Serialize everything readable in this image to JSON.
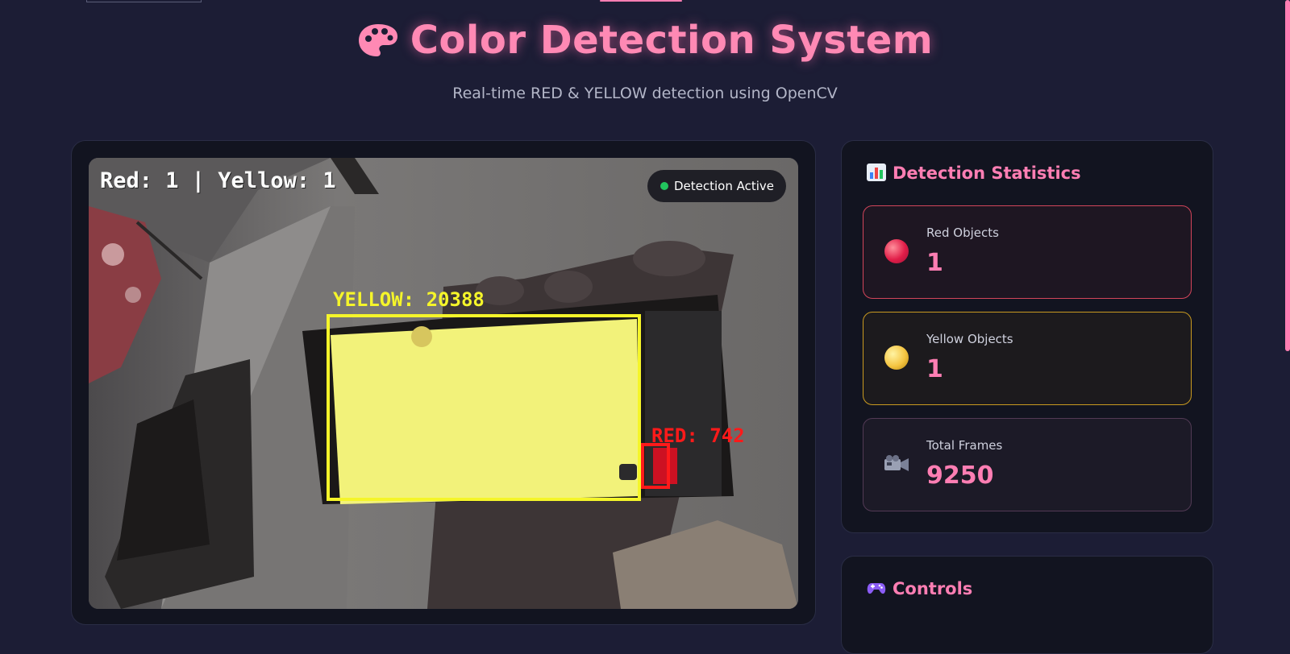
{
  "header": {
    "title": "Color Detection System",
    "subtitle": "Real-time RED & YELLOW detection using OpenCV",
    "icon": "palette-icon"
  },
  "video": {
    "overlay_text": "Red: 1 | Yellow: 1",
    "status_badge": "Detection Active",
    "detections": [
      {
        "label": "YELLOW: 20388",
        "color": "#f5f52a"
      },
      {
        "label": "RED: 742",
        "color": "#ff1a1a"
      }
    ]
  },
  "stats": {
    "heading": "Detection Statistics",
    "heading_icon": "bar-chart-icon",
    "cards": [
      {
        "label": "Red Objects",
        "value": "1",
        "icon": "red-circle-icon"
      },
      {
        "label": "Yellow Objects",
        "value": "1",
        "icon": "yellow-circle-icon"
      },
      {
        "label": "Total Frames",
        "value": "9250",
        "icon": "video-camera-icon"
      }
    ]
  },
  "controls": {
    "heading": "Controls",
    "heading_icon": "gamepad-icon"
  },
  "colors": {
    "accent": "#ff7eb3",
    "background": "#1c1d35",
    "panel": "#121420",
    "active_dot": "#22c55e"
  }
}
